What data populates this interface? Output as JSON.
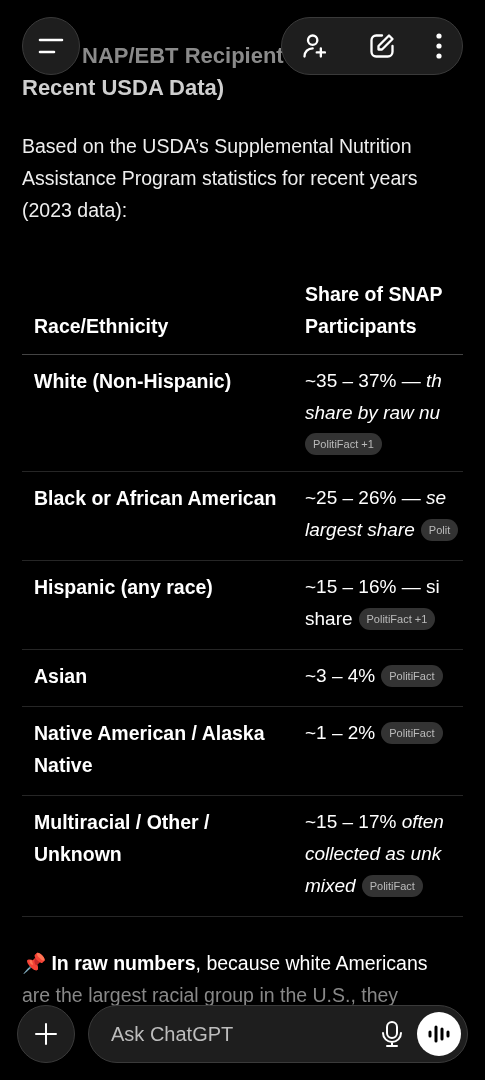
{
  "title_lines": [
    "NAP/EBT Recipient",
    "Recent USDA Data)"
  ],
  "intro": "Based on the USDA’s Supplemental Nutrition Assistance Program statistics for recent years (2023 data):",
  "table": {
    "columns": [
      "Race/Ethnicity",
      "Share of SNAP Participants"
    ],
    "rows": [
      {
        "group": "White (Non-Hispanic)",
        "share_lines": [
          "~35 – 37% — *th*",
          "*share by raw nu*"
        ],
        "citation": "PolitiFact +1"
      },
      {
        "group": "Black or African American",
        "share_lines": [
          "~25 – 26% — *se*",
          "*largest share*"
        ],
        "citation": "Polit"
      },
      {
        "group": "Hispanic (any race)",
        "share_lines": [
          "~15 – 16% — si",
          "share"
        ],
        "citation": "PolitiFact +1"
      },
      {
        "group": "Asian",
        "share_lines": [
          "~3 – 4%"
        ],
        "citation": "PolitiFact"
      },
      {
        "group": "Native American / Alaska Native",
        "share_lines": [
          "~1 – 2%"
        ],
        "citation": "PolitiFact"
      },
      {
        "group": "Multiracial / Other / Unknown",
        "share_lines": [
          "~15 – 17% *often*",
          "*collected as unk*",
          "*mixed*"
        ],
        "citation": "PolitiFact"
      }
    ]
  },
  "note": {
    "icon": "📌",
    "text": "**In raw numbers**, because white Americans",
    "faded_text": "are the largest racial group in the U.S., they"
  },
  "composer": {
    "placeholder": "Ask ChatGPT"
  }
}
